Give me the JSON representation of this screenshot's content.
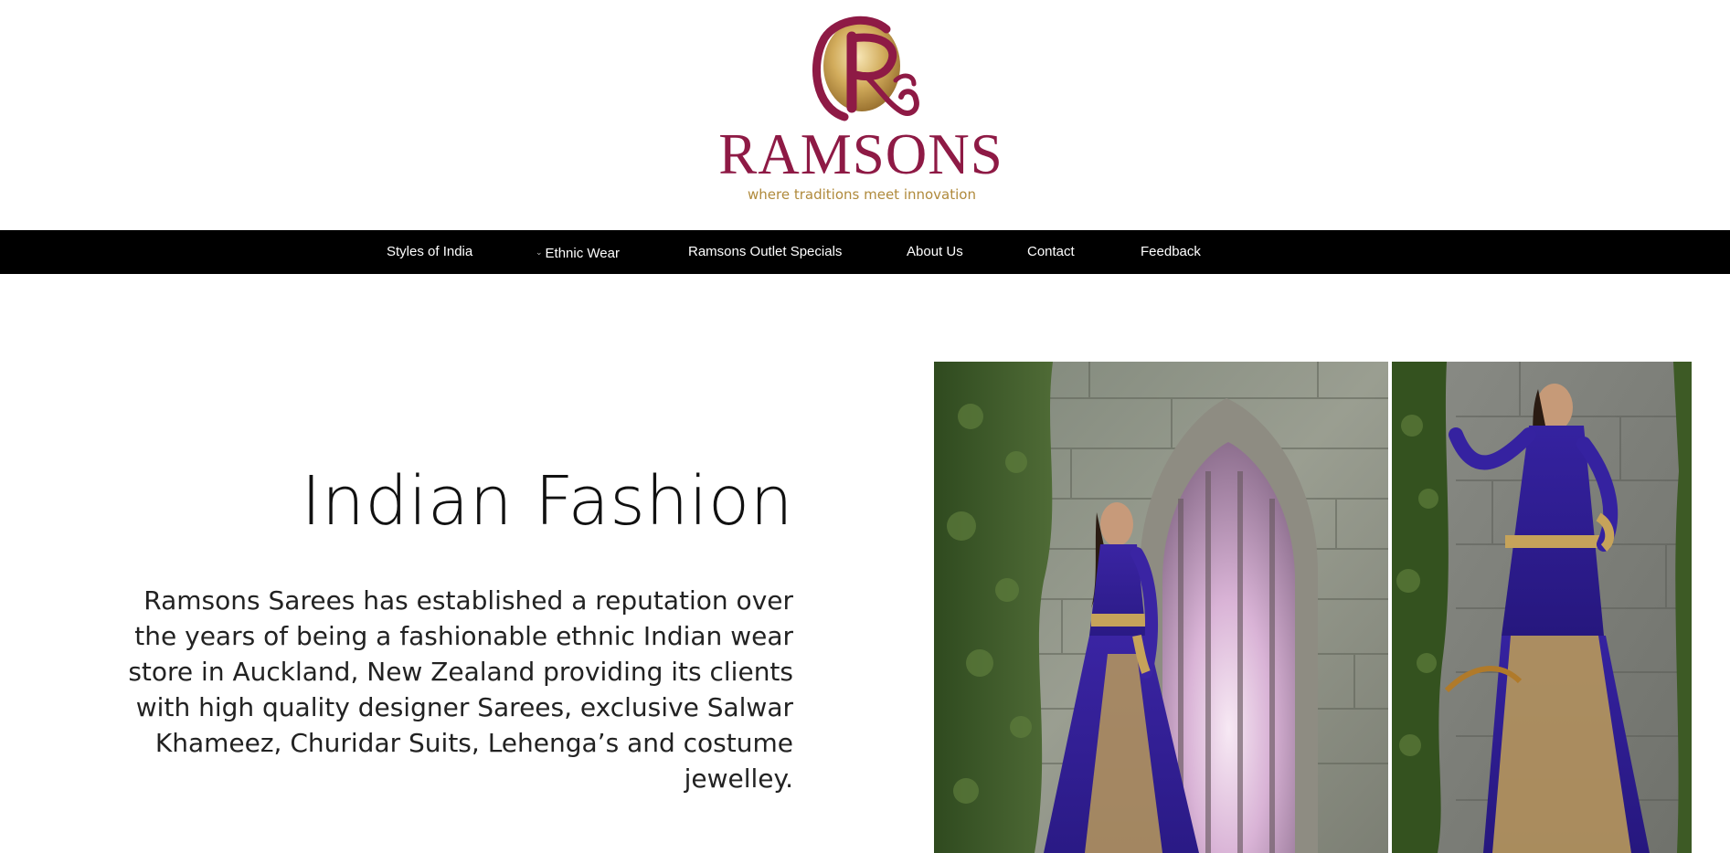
{
  "brand": {
    "name": "RAMSONS",
    "tagline": "where traditions meet innovation",
    "logo_colors": {
      "primary": "#8e1a45",
      "gold": "#b08a3c"
    }
  },
  "nav": {
    "items": [
      {
        "label": "Styles of India",
        "has_dropdown": false
      },
      {
        "label": "Ethnic Wear",
        "has_dropdown": true
      },
      {
        "label": "Ramsons Outlet Specials",
        "has_dropdown": false
      },
      {
        "label": "About Us",
        "has_dropdown": false
      },
      {
        "label": "Contact",
        "has_dropdown": false
      },
      {
        "label": "Feedback",
        "has_dropdown": false
      }
    ],
    "background": "#000000",
    "text_color": "#ffffff"
  },
  "main": {
    "heading": "Indian Fashion",
    "intro": "Ramsons Sarees has established a reputation over the years of being a fashionable ethnic Indian wear store in Auckland, New Zealand providing its clients with high quality designer Sarees, exclusive Salwar Khameez, Churidar Suits, Lehenga’s and costume jewelley."
  },
  "collage": {
    "photos": [
      {
        "icon": "fashion-photo-archway"
      },
      {
        "icon": "fashion-photo-stone-wall"
      }
    ]
  }
}
